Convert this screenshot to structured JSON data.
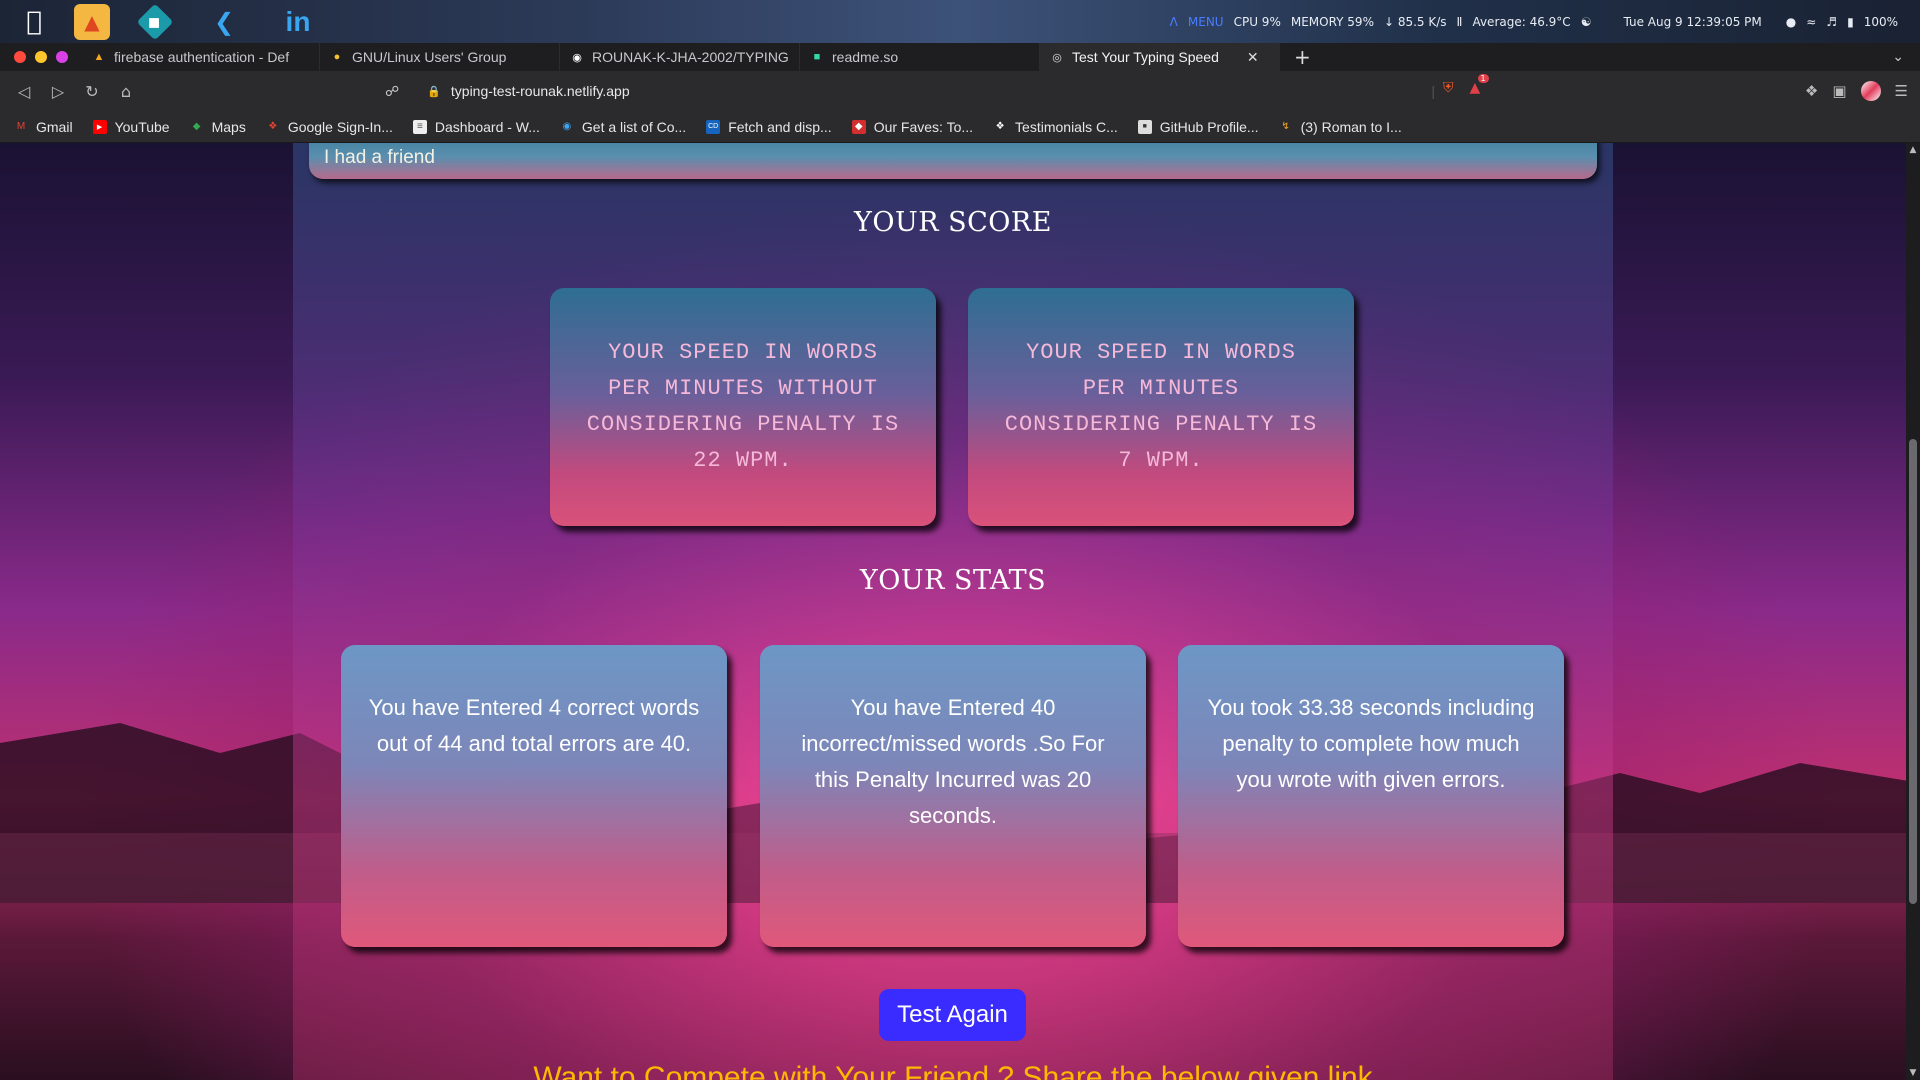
{
  "system_bar": {
    "apps": [
      "apple-menu",
      "brave",
      "kde-connect",
      "vscode",
      "linkedin"
    ],
    "linkedin_label": "in",
    "menu_label": "MENU",
    "cpu": "CPU  9%",
    "memory": "MEMORY  59%",
    "network": "↓ 85.5 K/s",
    "temperature": "Average: 46.9°C",
    "datetime": "Tue Aug 9  12:39:05 PM",
    "battery": "100%"
  },
  "tabs": [
    {
      "title": "firebase authentication - Def",
      "icon": "firebase-icon",
      "active": false
    },
    {
      "title": "GNU/Linux Users' Group",
      "icon": "gnu-icon",
      "active": false
    },
    {
      "title": "ROUNAK-K-JHA-2002/TYPING",
      "icon": "github-icon",
      "active": false
    },
    {
      "title": "readme.so",
      "icon": "readme-icon",
      "active": false
    },
    {
      "title": "Test Your Typing Speed",
      "icon": "globe-icon",
      "active": true
    }
  ],
  "address_bar": {
    "url": "typing-test-rounak.netlify.app",
    "shields_count": "1"
  },
  "bookmarks": [
    {
      "label": "Gmail",
      "icon": "gmail-icon"
    },
    {
      "label": "YouTube",
      "icon": "youtube-icon"
    },
    {
      "label": "Maps",
      "icon": "maps-icon"
    },
    {
      "label": "Google Sign-In...",
      "icon": "google-sign-in-icon"
    },
    {
      "label": "Dashboard - W...",
      "icon": "page-icon"
    },
    {
      "label": "Get a list of Co...",
      "icon": "globe-icon"
    },
    {
      "label": "Fetch and disp...",
      "icon": "cd-icon"
    },
    {
      "label": "Our Faves: To...",
      "icon": "faves-icon"
    },
    {
      "label": "Testimonials C...",
      "icon": "testimonials-icon"
    },
    {
      "label": "GitHub Profile...",
      "icon": "github-profile-icon"
    },
    {
      "label": "(3) Roman to I...",
      "icon": "leetcode-icon"
    }
  ],
  "page": {
    "typed_text": "I had a friend",
    "score_title": "YOUR SCORE",
    "score_cards": [
      "YOUR SPEED IN WORDS PER MINUTES WITHOUT CONSIDERING PENALTY IS 22 WPM.",
      "YOUR SPEED IN WORDS PER MINUTES CONSIDERING PENALTY IS 7 WPM."
    ],
    "stats_title": "YOUR STATS",
    "stat_cards": [
      "You have Entered 4 correct words out of 44 and total errors are 40.",
      "You have Entered 40 incorrect/missed words .So For this Penalty Incurred was 20 seconds.",
      "You took 33.38 seconds including penalty to complete how much you wrote with given errors."
    ],
    "test_again_label": "Test Again",
    "share_text": "Want to Compete with Your Friend ? Share the below given link"
  },
  "colors": {
    "button_blue": "#3a2bff",
    "share_text_orange": "#ffb800",
    "score_text_pink": "#f6b8d8"
  }
}
